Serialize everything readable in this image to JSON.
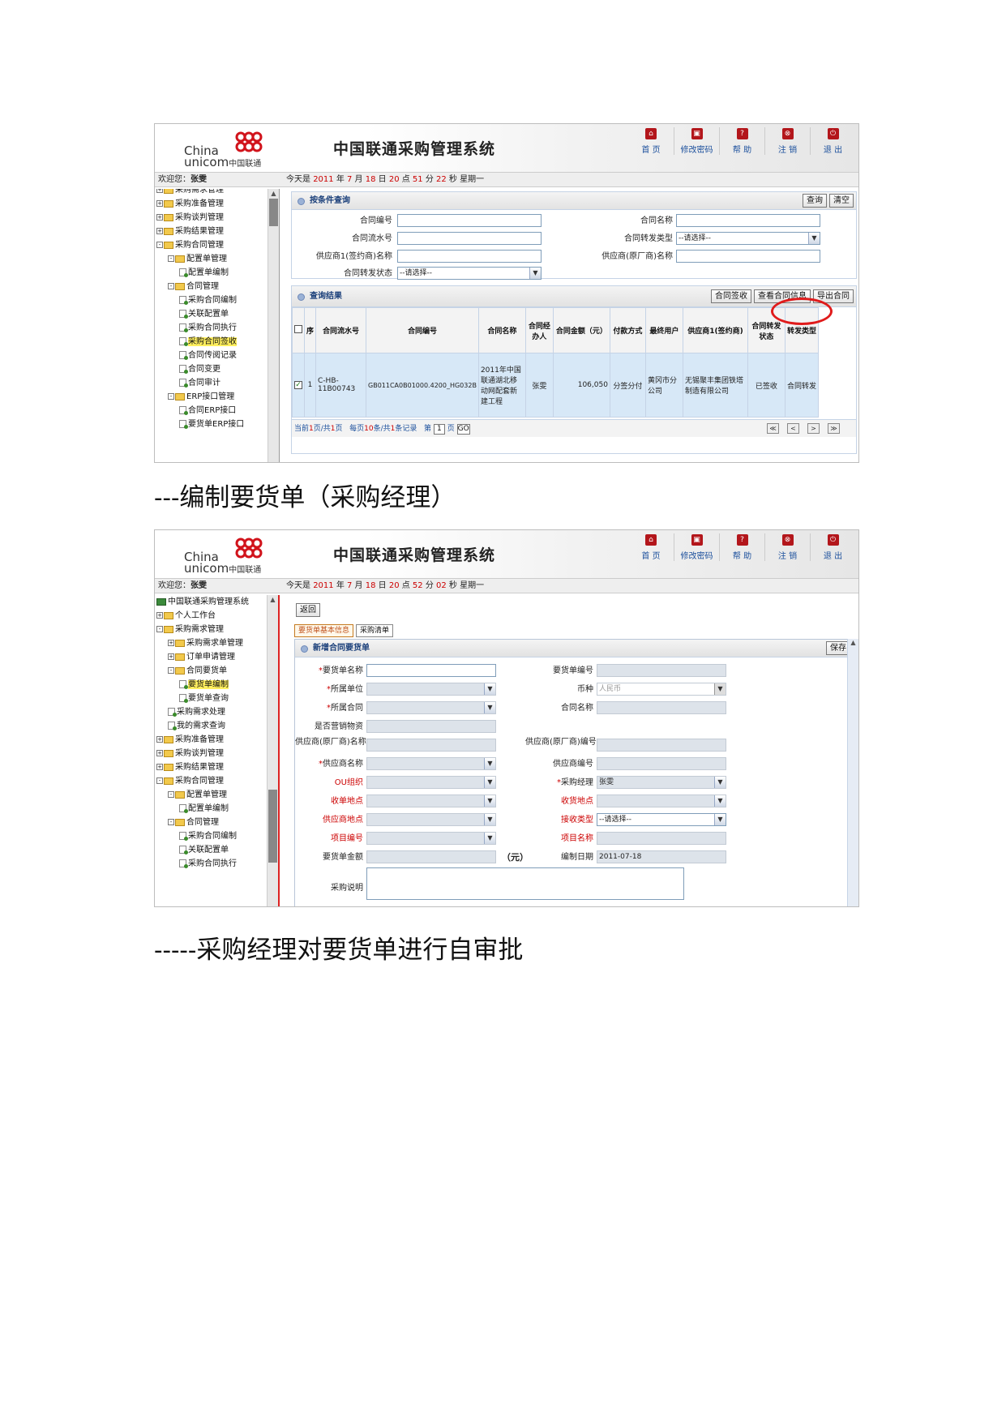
{
  "header": {
    "logo_en_1": "China",
    "logo_en_2": "unicom",
    "logo_cn": "中国联通",
    "system_title": "中国联通采购管理系统",
    "nav": [
      {
        "label": "首 页",
        "icon": "home-icon"
      },
      {
        "label": "修改密码",
        "icon": "lock-icon"
      },
      {
        "label": "帮 助",
        "icon": "help-icon"
      },
      {
        "label": "注 销",
        "icon": "logout-icon"
      },
      {
        "label": "退 出",
        "icon": "power-icon"
      }
    ]
  },
  "shot1": {
    "welcome_label": "欢迎您：",
    "user": "张雯",
    "date_prefix": "今天是",
    "year": "2011",
    "month": "7",
    "day": "18",
    "hour": "20",
    "minute": "51",
    "second": "22",
    "weekday": "星期一",
    "tree": [
      {
        "label": "采购需求管理",
        "type": "folder",
        "indent": 0,
        "exp": "+"
      },
      {
        "label": "采购准备管理",
        "type": "folder",
        "indent": 0,
        "exp": "+"
      },
      {
        "label": "采购谈判管理",
        "type": "folder",
        "indent": 0,
        "exp": "+"
      },
      {
        "label": "采购结果管理",
        "type": "folder",
        "indent": 0,
        "exp": "+"
      },
      {
        "label": "采购合同管理",
        "type": "folder",
        "indent": 0,
        "exp": "-"
      },
      {
        "label": "配置单管理",
        "type": "folder",
        "indent": 1,
        "exp": "-"
      },
      {
        "label": "配置单编制",
        "type": "page",
        "indent": 2
      },
      {
        "label": "合同管理",
        "type": "folder",
        "indent": 1,
        "exp": "-"
      },
      {
        "label": "采购合同编制",
        "type": "page",
        "indent": 2
      },
      {
        "label": "关联配置单",
        "type": "page",
        "indent": 2
      },
      {
        "label": "采购合同执行",
        "type": "page",
        "indent": 2
      },
      {
        "label": "采购合同签收",
        "type": "page",
        "indent": 2,
        "selected": true
      },
      {
        "label": "合同传阅记录",
        "type": "page",
        "indent": 2
      },
      {
        "label": "合同变更",
        "type": "page",
        "indent": 2
      },
      {
        "label": "合同审计",
        "type": "page",
        "indent": 2
      },
      {
        "label": "ERP接口管理",
        "type": "folder",
        "indent": 1,
        "exp": "-"
      },
      {
        "label": "合同ERP接口",
        "type": "page",
        "indent": 2
      },
      {
        "label": "要货单ERP接口",
        "type": "page",
        "indent": 2
      }
    ],
    "query": {
      "title": "按条件查询",
      "search_btn": "查询",
      "clear_btn": "清空",
      "contract_no": "合同编号",
      "contract_name": "合同名称",
      "serial_no": "合同流水号",
      "forward_type": "合同转发类型",
      "supplier1": "供应商1(签约商)名称",
      "supplier_mfr": "供应商(原厂商)名称",
      "forward_status": "合同转发状态",
      "select_placeholder": "--请选择--"
    },
    "results": {
      "title": "查询结果",
      "btn_sign": "合同签收",
      "btn_view": "查看合同信息",
      "btn_export": "导出合同",
      "columns": [
        "序",
        "合同流水号",
        "合同编号",
        "合同名称",
        "合同经办人",
        "合同金额（元）",
        "付款方式",
        "最终用户",
        "供应商1(签约商)",
        "合同转发状态",
        "转发类型"
      ],
      "rows": [
        {
          "seq": "1",
          "serial": "C-HB-11B00743",
          "contract_no": "GB011CA0B01000.4200_HG032B",
          "name": "2011年中国联通湖北移动网配套新建工程",
          "handler": "张雯",
          "amount": "106,050",
          "payment": "分签分付",
          "end_user": "黄冈市分公司",
          "supplier": "无锡聚丰集团铁塔制造有限公司",
          "status": "已签收",
          "type": "合同转发"
        }
      ],
      "pager": {
        "current": "当前",
        "page1": "1",
        "page_sep": "页/共",
        "total_pages": "1",
        "page_word": "页",
        "per_page": "每页",
        "size": "10",
        "per_suffix": "条/共",
        "records": "1",
        "records_suffix": "条记录",
        "goto_prefix": "第",
        "goto_value": "1",
        "goto_suffix": "页",
        "go": "GO"
      }
    }
  },
  "shot2": {
    "welcome_label": "欢迎您：",
    "user": "张雯",
    "date_prefix": "今天是",
    "year": "2011",
    "month": "7",
    "day": "18",
    "hour": "20",
    "minute": "52",
    "second": "02",
    "weekday": "星期一",
    "tree": [
      {
        "label": "中国联通采购管理系统",
        "type": "root",
        "indent": 0
      },
      {
        "label": "个人工作台",
        "type": "folder",
        "indent": 0,
        "exp": "+"
      },
      {
        "label": "采购需求管理",
        "type": "folder",
        "indent": 0,
        "exp": "-"
      },
      {
        "label": "采购需求单管理",
        "type": "folder",
        "indent": 1,
        "exp": "+"
      },
      {
        "label": "订单申请管理",
        "type": "folder",
        "indent": 1,
        "exp": "+"
      },
      {
        "label": "合同要货单",
        "type": "folder",
        "indent": 1,
        "exp": "-"
      },
      {
        "label": "要货单编制",
        "type": "page",
        "indent": 2,
        "selected": true
      },
      {
        "label": "要货单查询",
        "type": "page",
        "indent": 2
      },
      {
        "label": "采购需求处理",
        "type": "page",
        "indent": 1
      },
      {
        "label": "我的需求查询",
        "type": "page",
        "indent": 1
      },
      {
        "label": "采购准备管理",
        "type": "folder",
        "indent": 0,
        "exp": "+"
      },
      {
        "label": "采购谈判管理",
        "type": "folder",
        "indent": 0,
        "exp": "+"
      },
      {
        "label": "采购结果管理",
        "type": "folder",
        "indent": 0,
        "exp": "+"
      },
      {
        "label": "采购合同管理",
        "type": "folder",
        "indent": 0,
        "exp": "-"
      },
      {
        "label": "配置单管理",
        "type": "folder",
        "indent": 1,
        "exp": "-"
      },
      {
        "label": "配置单编制",
        "type": "page",
        "indent": 2
      },
      {
        "label": "合同管理",
        "type": "folder",
        "indent": 1,
        "exp": "-"
      },
      {
        "label": "采购合同编制",
        "type": "page",
        "indent": 2
      },
      {
        "label": "关联配置单",
        "type": "page",
        "indent": 2
      },
      {
        "label": "采购合同执行",
        "type": "page",
        "indent": 2
      }
    ],
    "back_btn": "返回",
    "tabs": [
      "要货单基本信息",
      "采购清单"
    ],
    "form_title": "新增合同要货单",
    "save_btn": "保存",
    "fields": {
      "order_name": "要货单名称",
      "order_no": "要货单编号",
      "unit": "所属单位",
      "currency": "币种",
      "currency_value": "人民币",
      "contract": "所属合同",
      "contract_name": "合同名称",
      "is_marketing": "是否营销物资",
      "mfr_name": "供应商(原厂商)名称",
      "mfr_no": "供应商(原厂商)编号",
      "supplier_name": "供应商名称",
      "supplier_no": "供应商编号",
      "ou_org": "OU组织",
      "manager": "采购经理",
      "manager_value": "张雯",
      "receive_place": "收单地点",
      "ship_place": "收货地点",
      "supplier_place": "供应商地点",
      "receive_type": "接收类型",
      "receive_type_value": "--请选择--",
      "project_no": "项目编号",
      "project_name": "项目名称",
      "amount": "要货单金额",
      "amount_unit": "（元）",
      "date_label": "编制日期",
      "date_value": "2011-07-18",
      "purchase_note": "采购说明"
    }
  },
  "captions": {
    "cap1": "---编制要货单（采购经理）",
    "cap2": "-----采购经理对要货单进行自审批"
  }
}
